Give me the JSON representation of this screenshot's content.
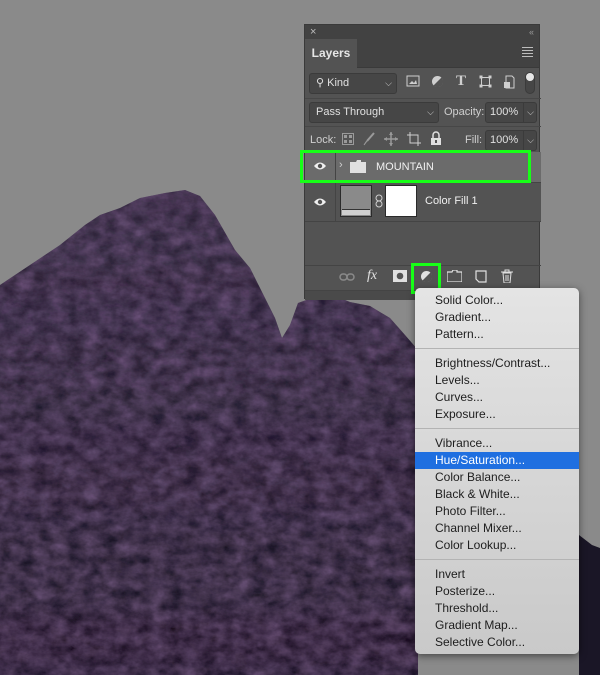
{
  "scene": {
    "background_color": "#8a8a8a",
    "subject": "dark purple-blue rocky mountain"
  },
  "panel": {
    "close_icon": "×",
    "collapse_icon": "‹‹",
    "tab_label": "Layers",
    "menu_icon": "hamburger-menu-icon",
    "filter": {
      "kind_label": "Kind",
      "icons": [
        "image-filter-icon",
        "adjustment-filter-icon",
        "type-filter-icon",
        "shape-filter-icon",
        "smart-object-filter-icon"
      ],
      "type_glyph": "T"
    },
    "blend_mode": "Pass Through",
    "opacity_label": "Opacity:",
    "opacity_value": "100%",
    "lock_label": "Lock:",
    "fill_label": "Fill:",
    "fill_value": "100%",
    "layers": [
      {
        "name": "MOUNTAIN",
        "type": "group",
        "selected": true,
        "visible": true
      },
      {
        "name": "Color Fill 1",
        "type": "fill",
        "selected": false,
        "visible": true
      }
    ],
    "bottom_icons": [
      "link-icon",
      "fx-icon",
      "mask-icon",
      "adjustment-layer-icon",
      "group-folder-icon",
      "new-layer-icon",
      "trash-icon"
    ],
    "fx_label": "fx"
  },
  "highlight_color": "#17ff17",
  "adjustment_menu": {
    "groups": [
      [
        "Solid Color...",
        "Gradient...",
        "Pattern..."
      ],
      [
        "Brightness/Contrast...",
        "Levels...",
        "Curves...",
        "Exposure..."
      ],
      [
        "Vibrance...",
        "Hue/Saturation...",
        "Color Balance...",
        "Black & White...",
        "Photo Filter...",
        "Channel Mixer...",
        "Color Lookup..."
      ],
      [
        "Invert",
        "Posterize...",
        "Threshold...",
        "Gradient Map...",
        "Selective Color..."
      ]
    ],
    "highlighted_item": "Hue/Saturation...",
    "highlight_color": "#1f6fe0"
  }
}
